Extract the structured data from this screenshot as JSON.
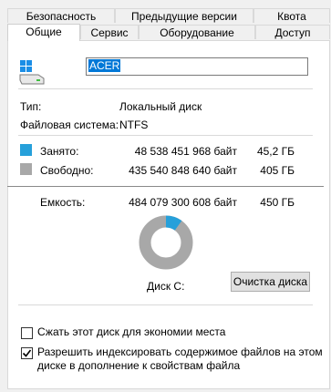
{
  "tabs_row1": [
    {
      "label": "Безопасность"
    },
    {
      "label": "Предыдущие версии"
    },
    {
      "label": "Квота"
    }
  ],
  "tabs_row2": [
    {
      "label": "Общие"
    },
    {
      "label": "Сервис"
    },
    {
      "label": "Оборудование"
    },
    {
      "label": "Доступ"
    }
  ],
  "selected_tab": "Общие",
  "drive_name": "ACER",
  "type_label": "Тип:",
  "type_value": "Локальный диск",
  "fs_label": "Файловая система:",
  "fs_value": "NTFS",
  "used": {
    "label": "Занято:",
    "bytes": "48 538 451 968 байт",
    "size": "45,2 ГБ",
    "color": "#26a0da"
  },
  "free": {
    "label": "Свободно:",
    "bytes": "435 540 848 640 байт",
    "size": "405 ГБ",
    "color": "#a8a8a8"
  },
  "capacity": {
    "label": "Емкость:",
    "bytes": "484 079 300 608 байт",
    "size": "450 ГБ"
  },
  "used_fraction": 0.1,
  "disk_label": "Диск C:",
  "cleanup_button": "Очистка диска",
  "compress": {
    "label": "Сжать этот диск для экономии места",
    "checked": false
  },
  "index": {
    "line1": "Разрешить индексировать содержимое файлов на этом",
    "line2": "диске в дополнение к свойствам файла",
    "checked": true
  }
}
